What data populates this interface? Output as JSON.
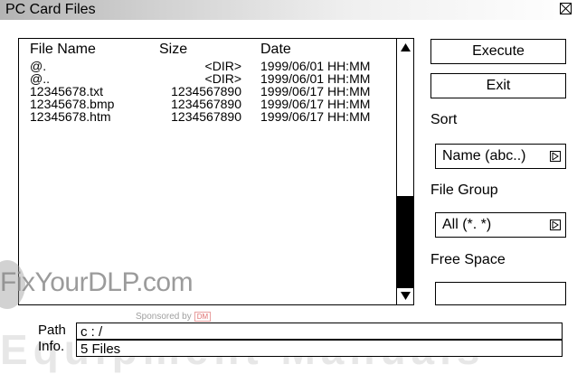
{
  "window": {
    "title": "PC Card Files"
  },
  "file_list": {
    "columns": {
      "name": "File Name",
      "size": "Size",
      "date": "Date"
    },
    "rows": [
      {
        "name": "@.",
        "size": "<DIR>",
        "date": "1999/06/01 HH:MM"
      },
      {
        "name": "@..",
        "size": "<DIR>",
        "date": "1999/06/01 HH:MM"
      },
      {
        "name": "12345678.txt",
        "size": "1234567890",
        "date": "1999/06/17 HH:MM"
      },
      {
        "name": "12345678.bmp",
        "size": "1234567890",
        "date": "1999/06/17 HH:MM"
      },
      {
        "name": "12345678.htm",
        "size": "1234567890",
        "date": "1999/06/17 HH:MM"
      }
    ]
  },
  "buttons": {
    "execute": "Execute",
    "exit": "Exit"
  },
  "sort": {
    "label": "Sort",
    "value": "Name (abc..)"
  },
  "file_group": {
    "label": "File Group",
    "value": "All (*. *)"
  },
  "free_space": {
    "label": "Free Space",
    "value": ""
  },
  "path": {
    "label": "Path",
    "value": "c : /"
  },
  "info": {
    "label": "Info.",
    "value": "5 Files"
  },
  "watermark": {
    "logo": "FixYourDLP.com",
    "sponsored": "Sponsored by",
    "badge": "DM",
    "bottom": "Equipment Manuals"
  }
}
